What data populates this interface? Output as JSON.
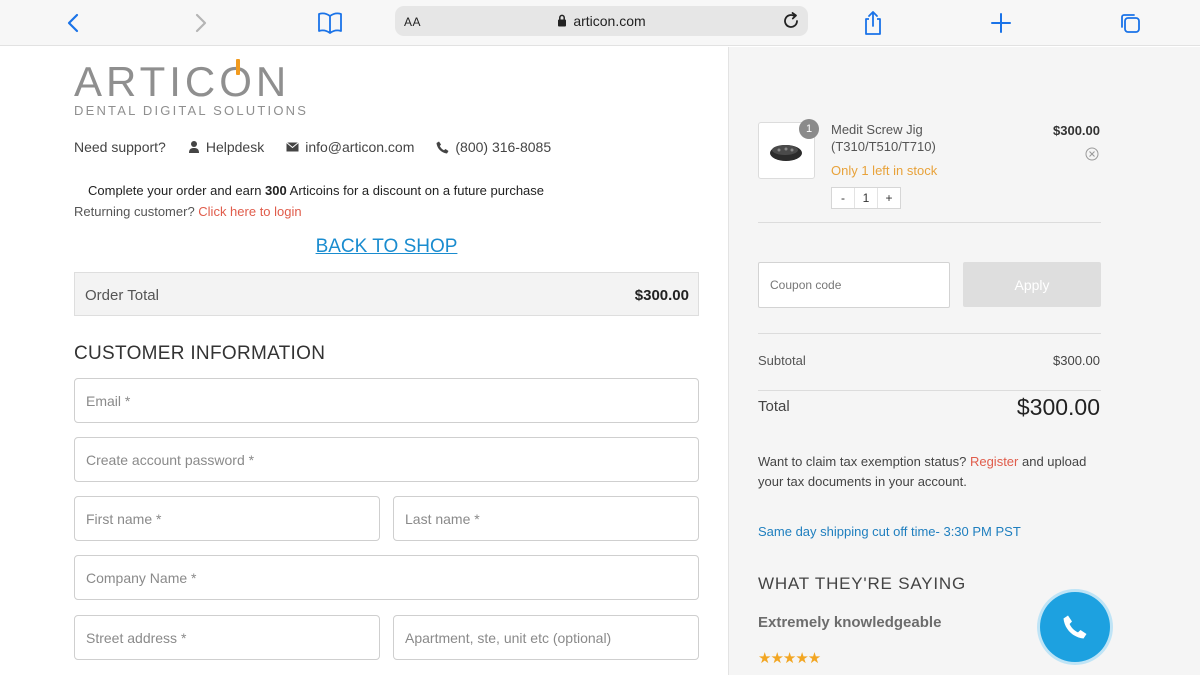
{
  "browser": {
    "address_aa": "AA",
    "url": "articon.com"
  },
  "logo": {
    "word_before": "ARTIC",
    "word_o": "O",
    "word_after": "N",
    "tagline": "DENTAL DIGITAL SOLUTIONS",
    "accent_color": "#f29b1e"
  },
  "support": {
    "label": "Need support?",
    "helpdesk": "Helpdesk",
    "email": "info@articon.com",
    "phone": "(800) 316-8085"
  },
  "promo": {
    "prefix": "Complete your order and earn ",
    "coins": "300",
    "suffix": " Articoins for a discount on a future purchase"
  },
  "returning": {
    "text": "Returning customer? ",
    "link": "Click here to login"
  },
  "back_to_shop": "BACK TO SHOP",
  "order_total": {
    "label": "Order Total",
    "value": "$300.00"
  },
  "customer_info": {
    "heading": "CUSTOMER INFORMATION",
    "fields": {
      "email": "Email *",
      "password": "Create account password *",
      "first_name": "First name *",
      "last_name": "Last name *",
      "company": "Company Name *",
      "street": "Street address *",
      "apartment": "Apartment, ste, unit etc (optional)"
    }
  },
  "cart": {
    "item": {
      "quantity_badge": "1",
      "name": "Medit Screw Jig (T310/T510/T710)",
      "stock": "Only 1 left in stock",
      "quantity": "1",
      "minus": "-",
      "plus": "+",
      "price": "$300.00"
    },
    "coupon_placeholder": "Coupon code",
    "apply_label": "Apply",
    "subtotal_label": "Subtotal",
    "subtotal_value": "$300.00",
    "total_label": "Total",
    "total_value": "$300.00"
  },
  "tax": {
    "prefix": "Want to claim tax exemption status? ",
    "link": "Register",
    "suffix": " and upload your tax documents in your account."
  },
  "shipping": "Same day shipping cut off time- 3:30 PM PST",
  "testimonials": {
    "heading": "WHAT THEY'RE SAYING",
    "review_title": "Extremely knowledgeable",
    "stars": "★★★★★",
    "rating": 5
  },
  "colors": {
    "link_blue": "#1a8ccf",
    "link_red": "#e05c4b",
    "stock_orange": "#e8a23a",
    "fab_blue": "#1da1e0"
  }
}
